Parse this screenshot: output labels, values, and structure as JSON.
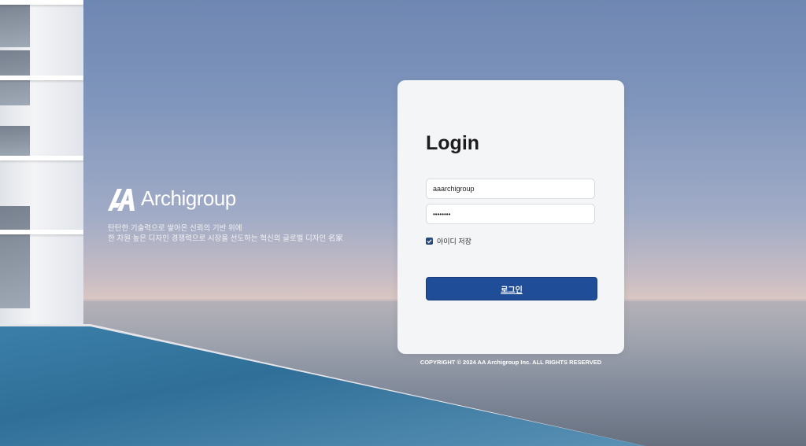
{
  "brand": {
    "name": "Archigroup",
    "tagline_line1": "탄탄한 기술력으로 쌓아온 신뢰의 기반 위에",
    "tagline_line2": "한 차원 높은 디자인 경쟁력으로 시장을 선도하는 혁신의 글로벌 디자인 名家"
  },
  "login": {
    "title": "Login",
    "username_value": "aaarchigroup",
    "password_value": "••••••••",
    "remember_label": "아이디 저장",
    "remember_checked": true,
    "submit_label": "로그인"
  },
  "footer": {
    "copyright": "COPYRIGHT © 2024 AA Archigroup Inc. ALL RIGHTS RESERVED"
  },
  "colors": {
    "button": "#1f4d98",
    "checkbox": "#264a7e"
  }
}
